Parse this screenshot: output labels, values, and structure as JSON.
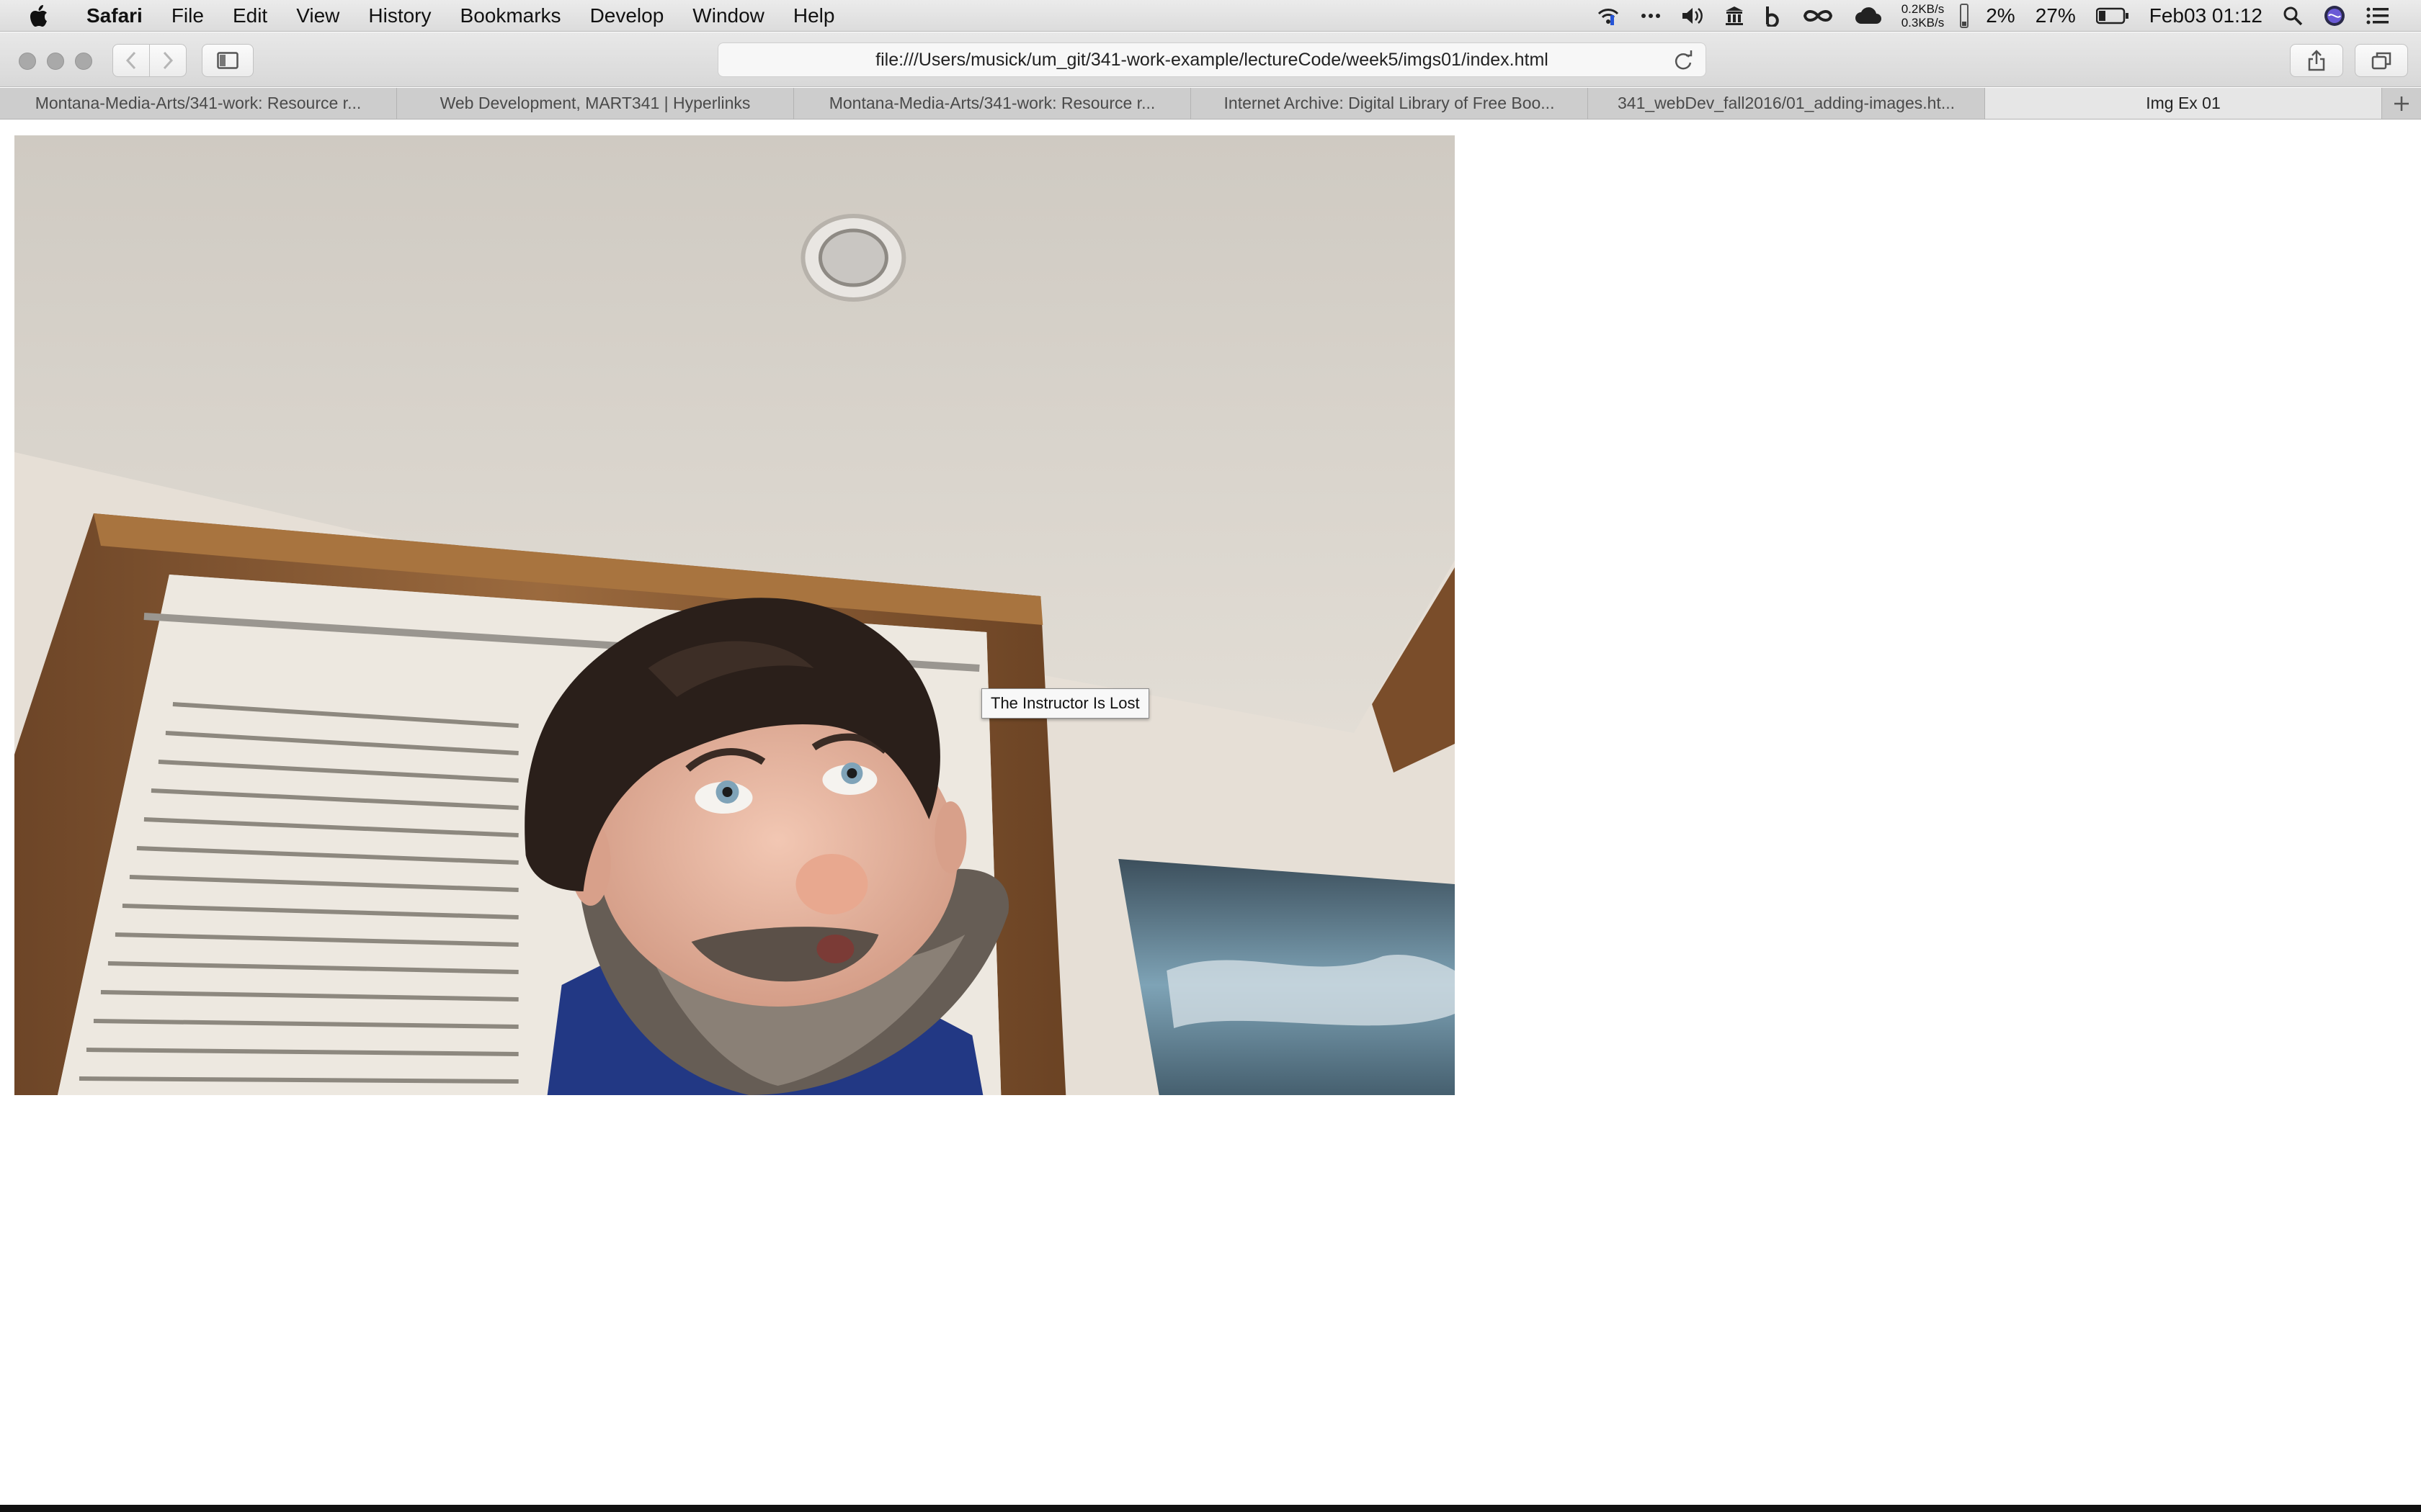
{
  "menubar": {
    "app_name": "Safari",
    "items": [
      "File",
      "Edit",
      "View",
      "History",
      "Bookmarks",
      "Develop",
      "Window",
      "Help"
    ],
    "net_up": "0.2KB/s",
    "net_down": "0.3KB/s",
    "cpu": "2%",
    "battery": "27%",
    "clock": "Feb03 01:12",
    "icons": [
      "wifi-icon",
      "more-icon",
      "volume-icon",
      "museum-icon",
      "b-icon",
      "infinity-icon",
      "cloud-icon",
      "battery-icon",
      "spotlight-icon",
      "siri-icon",
      "notification-list-icon"
    ]
  },
  "toolbar": {
    "url": "file:///Users/musick/um_git/341-work-example/lectureCode/week5/imgs01/index.html"
  },
  "tabs": [
    "Montana-Media-Arts/341-work: Resource r...",
    "Web Development, MART341 | Hyperlinks",
    "Montana-Media-Arts/341-work: Resource r...",
    "Internet Archive: Digital Library of Free Boo...",
    "341_webDev_fall2016/01_adding-images.ht...",
    "Img Ex 01"
  ],
  "page": {
    "image_alt": "The Instructor Is Lost",
    "tooltip": "The Instructor Is Lost"
  },
  "colors": {
    "ceiling": "#d9d4cb",
    "wall": "#e7e0d8",
    "wood_trim": "#8a5a33",
    "hair": "#2a1f1a",
    "beard": "#6e645b",
    "hoodie": "#233b86"
  }
}
